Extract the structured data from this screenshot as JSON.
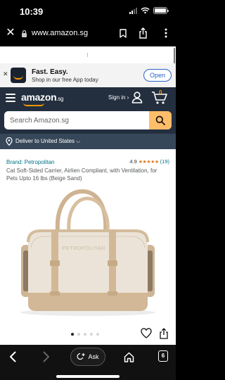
{
  "status_bar": {
    "time": "10:39"
  },
  "browser": {
    "url": "www.amazon.sg"
  },
  "app_banner": {
    "title": "Fast. Easy.",
    "subtitle": "Shop in our free App today",
    "open_label": "Open"
  },
  "header": {
    "logo": "amazon",
    "logo_tld": ".sg",
    "signin_label": "Sign in ›",
    "cart_count": "0",
    "brand_accent": "#ff9900",
    "bg_color": "#232f3e"
  },
  "search": {
    "placeholder": "Search Amazon.sg"
  },
  "deliver": {
    "text": "Deliver to United States ⌵"
  },
  "product": {
    "brand": "Brand: Petropolitan",
    "rating": "4.9",
    "stars": "★★★★★",
    "review_count": "(19)",
    "title": "Cat Soft-Sided Carrier, Airlien Compliant, with Ventilation, for Pets Upto 16 lbs (Beige Sand)",
    "image_logo_text": "PETROPOLITAN",
    "image_count": 5,
    "active_image": 1
  },
  "toolbar": {
    "ask_label": "Ask",
    "tab_count": "6"
  }
}
